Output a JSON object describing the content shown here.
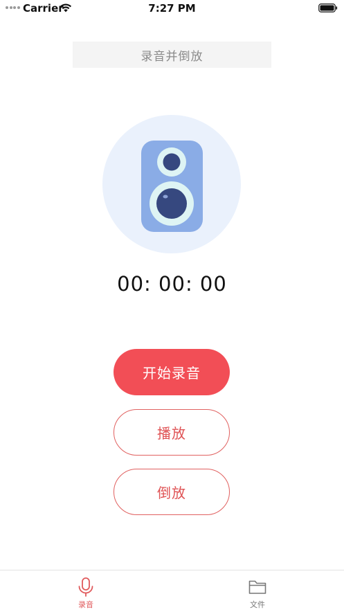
{
  "status_bar": {
    "carrier": "Carrier",
    "time": "7:27 PM"
  },
  "header": {
    "title": "录音并倒放"
  },
  "illustration": {
    "icon": "speaker-icon"
  },
  "timer": {
    "value": "00: 00: 00"
  },
  "buttons": {
    "record_label": "开始录音",
    "play_label": "播放",
    "reverse_label": "倒放"
  },
  "tab_bar": {
    "tabs": [
      {
        "label": "录音",
        "icon": "microphone-icon",
        "active": true
      },
      {
        "label": "文件",
        "icon": "folder-icon",
        "active": false
      }
    ]
  },
  "colors": {
    "accent": "#f24e56",
    "tab_active": "#e05a5c",
    "tab_inactive": "#777777",
    "illustration_bg": "#eaf1fc",
    "speaker_body": "#8aace6",
    "speaker_cone": "#36487f",
    "speaker_ring": "#def4f4"
  }
}
